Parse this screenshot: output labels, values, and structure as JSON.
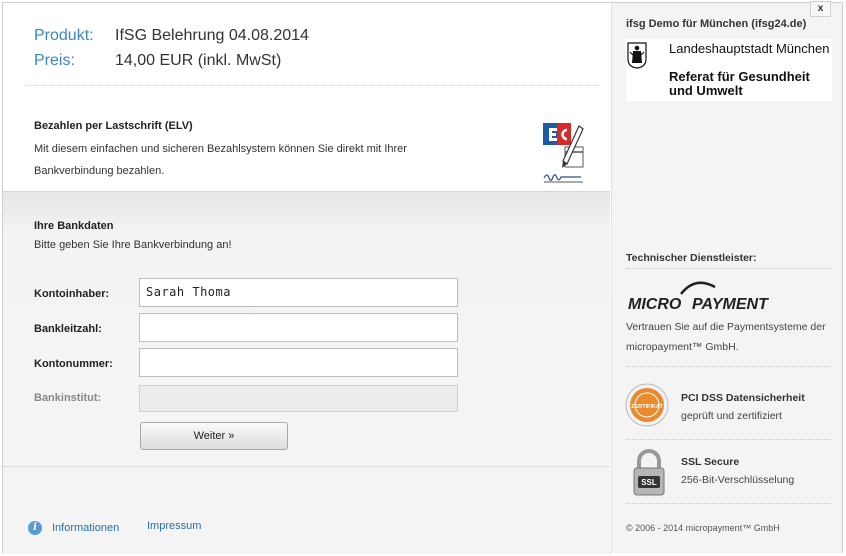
{
  "product": {
    "product_label": "Produkt:",
    "product_value": "IfSG Belehrung 04.08.2014",
    "price_label": "Preis:",
    "price_value": "14,00 EUR (inkl. MwSt)"
  },
  "payment": {
    "title": "Bezahlen per Lastschrift (ELV)",
    "description": "Mit diesem einfachen und sicheren Bezahlsystem können Sie direkt mit Ihrer Bankverbindung bezahlen."
  },
  "bank": {
    "title": "Ihre Bankdaten",
    "subtitle": "Bitte geben Sie Ihre Bankverbindung an!",
    "fields": [
      {
        "label": "Kontoinhaber:",
        "value": "Sarah Thoma"
      },
      {
        "label": "Bankleitzahl:",
        "value": ""
      },
      {
        "label": "Kontonummer:",
        "value": ""
      },
      {
        "label": "Bankinstitut:",
        "value": ""
      }
    ],
    "submit_label": "Weiter »"
  },
  "footer": {
    "info_label": "Informationen",
    "impressum_label": "Impressum"
  },
  "sidebar": {
    "close_label": "x",
    "merchant_title": "ifsg Demo für München (ifsg24.de)",
    "logo_line1": "Landeshauptstadt München",
    "logo_line2": "Referat für Gesundheit und Umwelt",
    "tech_label": "Technischer Dienstleister:",
    "mp_logo_left": "MICRO",
    "mp_logo_right": "PAYMENT",
    "trust_text": "Vertrauen Sie auf die Paymentsysteme der micropayment™ GmbH.",
    "pci_title": "PCI DSS Datensicherheit",
    "pci_sub": "geprüft und zertifiziert",
    "pci_badge_text": "ZERTIFIKAT",
    "ssl_title": "SSL Secure",
    "ssl_sub": "256-Bit-Verschlüsselung",
    "ssl_badge_text": "SSL",
    "copyright": "© 2006 - 2014 micropayment™ GmbH"
  },
  "colors": {
    "accent": "#3a87c4",
    "link": "#2a6fb0",
    "pci_orange": "#e88a2e"
  }
}
